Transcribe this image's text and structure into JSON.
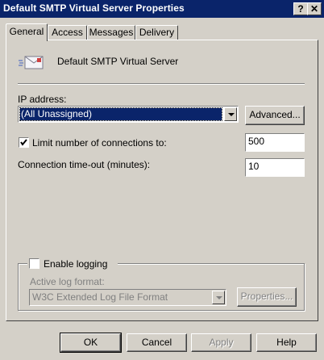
{
  "window": {
    "title": "Default SMTP Virtual Server Properties",
    "help_glyph": "?",
    "close_glyph": "✕"
  },
  "tabs": [
    {
      "label": "General",
      "active": true
    },
    {
      "label": "Access",
      "active": false
    },
    {
      "label": "Messages",
      "active": false
    },
    {
      "label": "Delivery",
      "active": false
    }
  ],
  "general": {
    "server_icon": "smtp-server-icon",
    "server_name": "Default SMTP Virtual Server",
    "ip_label": "IP address:",
    "ip_value": "(All Unassigned)",
    "advanced_label": "Advanced...",
    "limit_connections": {
      "label": "Limit number of connections to:",
      "checked": true,
      "value": "500"
    },
    "timeout": {
      "label": "Connection time-out (minutes):",
      "value": "10"
    },
    "logging": {
      "label": "Enable logging",
      "checked": false,
      "format_label": "Active log format:",
      "format_value": "W3C Extended Log File Format",
      "properties_label": "Properties..."
    }
  },
  "footer": {
    "ok": "OK",
    "cancel": "Cancel",
    "apply": "Apply",
    "help": "Help"
  }
}
